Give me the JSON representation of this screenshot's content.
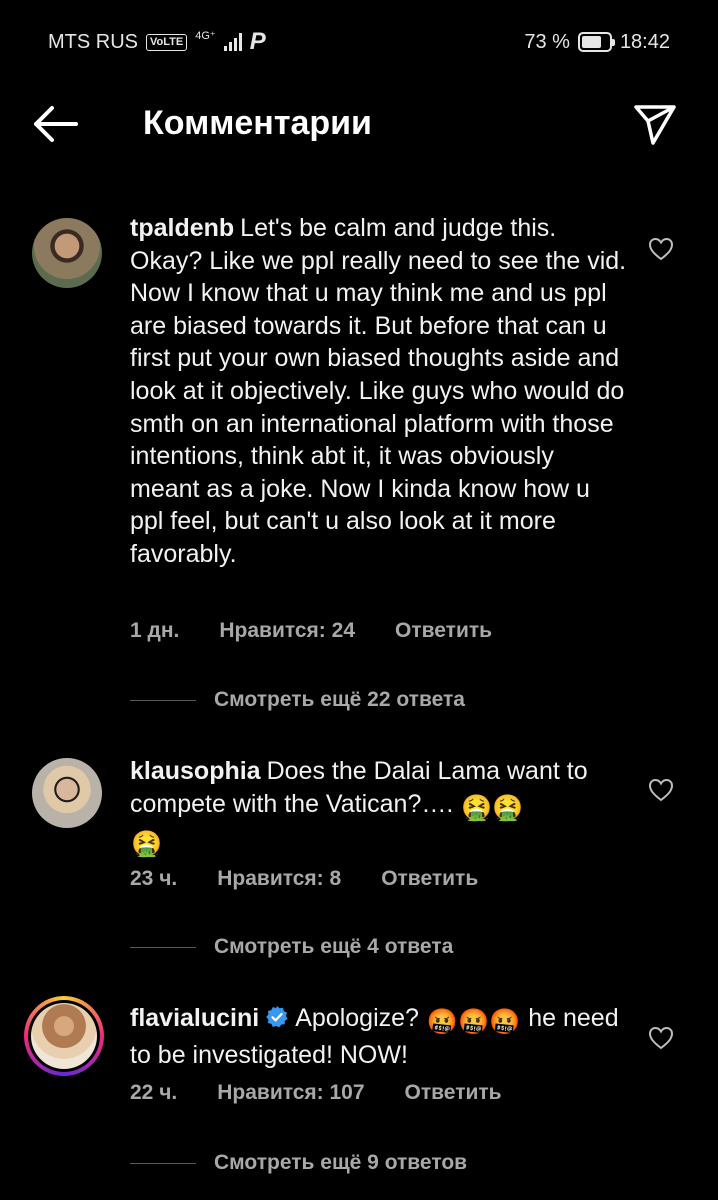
{
  "status_bar": {
    "carrier": "MTS RUS",
    "volte": "VoLTE",
    "network": "4G⁺",
    "battery_percent": "73 %",
    "time": "18:42",
    "battery_level": 0.73
  },
  "header": {
    "title": "Комментарии",
    "back_icon": "arrow-left-icon",
    "send_icon": "paper-plane-icon"
  },
  "comments": [
    {
      "username": "tpaldenb",
      "text": "Let's be calm and judge this. Okay? Like we ppl really need to see the vid. Now I know that u may think me and us ppl are biased towards it. But before that can u first put your own biased thoughts aside and look at it objectively. Like guys who would do smth on an international platform with those intentions, think abt it, it was obviously meant as a joke. Now I kinda know how u ppl feel, but can't u also look at it more favorably.",
      "time": "1 дн.",
      "likes": "Нравится: 24",
      "reply": "Ответить",
      "more_replies": "Смотреть ещё 22 ответа"
    },
    {
      "username": "klausophia",
      "text": "Does the Dalai Lama want to compete with the Vatican?….",
      "emojis_1": "🤮🤮",
      "emojis_2": "🤮",
      "time": "23 ч.",
      "likes": "Нравится: 8",
      "reply": "Ответить",
      "more_replies": "Смотреть ещё 4 ответа"
    },
    {
      "username": "flavialucini",
      "verified": true,
      "text_before": "Apologize?",
      "emojis": "🤬🤬🤬",
      "text_after": "he need to be investigated! NOW!",
      "time": "22 ч.",
      "likes": "Нравится: 107",
      "reply": "Ответить",
      "more_replies": "Смотреть ещё 9 ответов"
    }
  ],
  "colors": {
    "background": "#000000",
    "text": "#f2f2f2",
    "muted": "#a8a8a8",
    "verified": "#3897f0"
  }
}
